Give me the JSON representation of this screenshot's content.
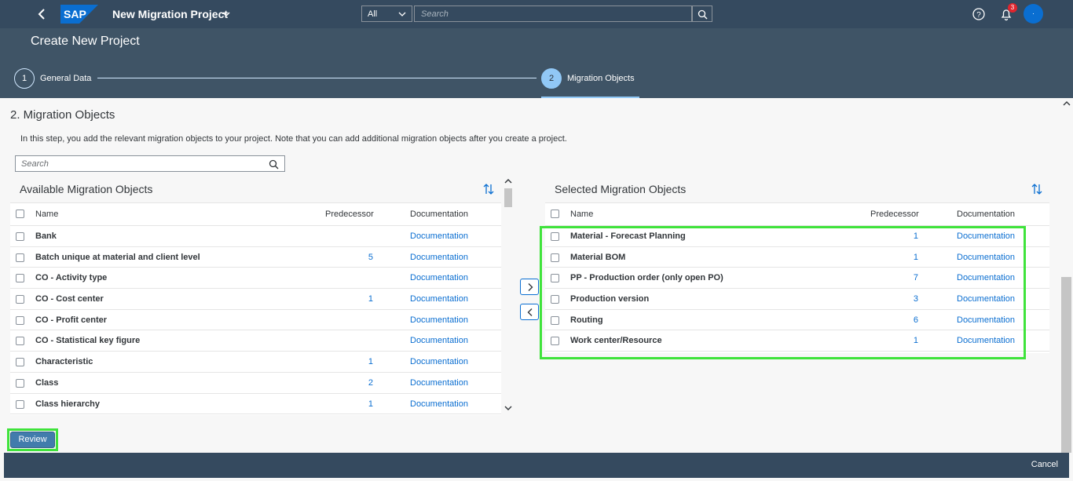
{
  "shell": {
    "app_title": "New Migration Project",
    "scope": "All",
    "search_placeholder": "Search",
    "notification_count": "3",
    "avatar_initial": "·"
  },
  "wizard": {
    "page_title": "Create New Project",
    "steps": [
      {
        "number": "1",
        "label": "General Data"
      },
      {
        "number": "2",
        "label": "Migration Objects"
      }
    ]
  },
  "section": {
    "title": "2. Migration Objects",
    "intro": "In this step, you add the relevant migration objects to your project. Note that you can add additional migration objects after you create a project.",
    "search_placeholder": "Search"
  },
  "available": {
    "title": "Available Migration Objects",
    "columns": {
      "name": "Name",
      "predecessor": "Predecessor",
      "documentation": "Documentation"
    },
    "rows": [
      {
        "name": "Bank",
        "predecessor": "",
        "doc": "Documentation"
      },
      {
        "name": "Batch unique at material and client level",
        "predecessor": "5",
        "doc": "Documentation"
      },
      {
        "name": "CO - Activity type",
        "predecessor": "",
        "doc": "Documentation"
      },
      {
        "name": "CO - Cost center",
        "predecessor": "1",
        "doc": "Documentation"
      },
      {
        "name": "CO - Profit center",
        "predecessor": "",
        "doc": "Documentation"
      },
      {
        "name": "CO - Statistical key figure",
        "predecessor": "",
        "doc": "Documentation"
      },
      {
        "name": "Characteristic",
        "predecessor": "1",
        "doc": "Documentation"
      },
      {
        "name": "Class",
        "predecessor": "2",
        "doc": "Documentation"
      },
      {
        "name": "Class hierarchy",
        "predecessor": "1",
        "doc": "Documentation"
      }
    ]
  },
  "selected": {
    "title": "Selected Migration Objects",
    "columns": {
      "name": "Name",
      "predecessor": "Predecessor",
      "documentation": "Documentation"
    },
    "rows": [
      {
        "name": "Material - Forecast Planning",
        "predecessor": "1",
        "doc": "Documentation"
      },
      {
        "name": "Material BOM",
        "predecessor": "1",
        "doc": "Documentation"
      },
      {
        "name": "PP - Production order (only open PO)",
        "predecessor": "7",
        "doc": "Documentation"
      },
      {
        "name": "Production version",
        "predecessor": "3",
        "doc": "Documentation"
      },
      {
        "name": "Routing",
        "predecessor": "6",
        "doc": "Documentation"
      },
      {
        "name": "Work center/Resource",
        "predecessor": "1",
        "doc": "Documentation"
      }
    ]
  },
  "actions": {
    "review_label": "Review",
    "cancel_label": "Cancel"
  },
  "colors": {
    "shell": "#354a5f",
    "header": "#3f5466",
    "link": "#0a6ed1",
    "highlight": "#3fe33b",
    "emphasized_button": "#427cac"
  }
}
